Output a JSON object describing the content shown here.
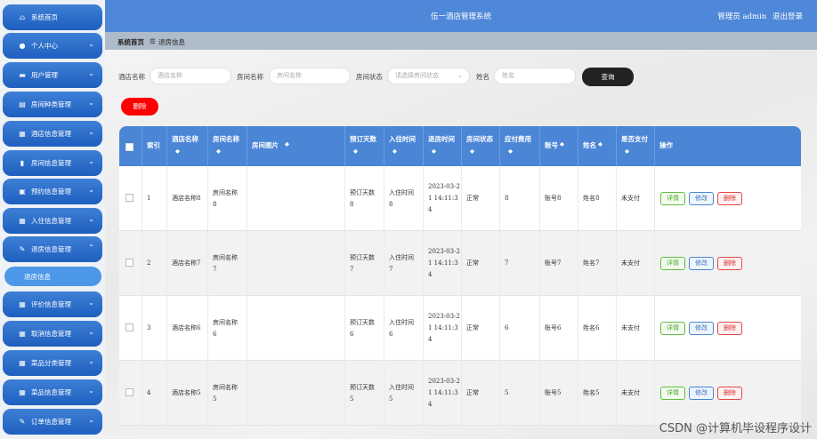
{
  "app_title": "伍一酒店管理系统",
  "user_text": "管理员 admin",
  "logout": "退出登录",
  "breadcrumb": {
    "home": "系统首页",
    "sep": "☰",
    "current": "退房信息"
  },
  "sidebar": {
    "items": [
      {
        "label": "系统首页",
        "icon": "home-icon"
      },
      {
        "label": "个人中心",
        "icon": "person-icon"
      },
      {
        "label": "用户管理",
        "icon": "briefcase-icon"
      },
      {
        "label": "房间种类管理",
        "icon": "bed-icon"
      },
      {
        "label": "酒店信息管理",
        "icon": "grid-icon"
      },
      {
        "label": "房间信息管理",
        "icon": "chart-icon"
      },
      {
        "label": "预约信息管理",
        "icon": "stack-icon"
      },
      {
        "label": "入住信息管理",
        "icon": "grid-icon"
      },
      {
        "label": "退房信息管理",
        "icon": "edit-icon"
      },
      {
        "label": "评价信息管理",
        "icon": "grid-icon"
      },
      {
        "label": "取消信息管理",
        "icon": "grid-icon"
      },
      {
        "label": "菜品分类管理",
        "icon": "grid-icon"
      },
      {
        "label": "菜品信息管理",
        "icon": "grid-icon"
      },
      {
        "label": "订单信息管理",
        "icon": "edit-icon"
      }
    ],
    "sub_active": "退房信息"
  },
  "search": {
    "hotel_label": "酒店名称",
    "hotel_placeholder": "酒店名称",
    "room_label": "房间名称",
    "room_placeholder": "房间名称",
    "status_label": "房间状态",
    "status_placeholder": "请选择房间状态",
    "name_label": "姓名",
    "name_placeholder": "姓名",
    "search_button": "查询"
  },
  "delete_button": "删除",
  "table": {
    "headers": [
      "索引",
      "酒店名称",
      "房间名称",
      "房间图片",
      "预订天数",
      "入住时间",
      "退房时间",
      "房间状态",
      "应付费用",
      "账号",
      "姓名",
      "是否支付",
      "操作"
    ],
    "sort_mark": "◆",
    "rows": [
      {
        "idx": "1",
        "hotel": "酒店名称8",
        "room1": "房间名称",
        "room2": "8",
        "days1": "预订天数",
        "days2": "8",
        "in1": "入住时间",
        "in2": "8",
        "out1": "2023-03-2",
        "out2": "1 14:11:3",
        "out3": "4",
        "status": "正常",
        "fee": "8",
        "acct": "账号8",
        "name": "姓名8",
        "paid": "未支付"
      },
      {
        "idx": "2",
        "hotel": "酒店名称7",
        "room1": "房间名称",
        "room2": "7",
        "days1": "预订天数",
        "days2": "7",
        "in1": "入住时间",
        "in2": "7",
        "out1": "2023-03-2",
        "out2": "1 14:11:3",
        "out3": "4",
        "status": "正常",
        "fee": "7",
        "acct": "账号7",
        "name": "姓名7",
        "paid": "未支付"
      },
      {
        "idx": "3",
        "hotel": "酒店名称6",
        "room1": "房间名称",
        "room2": "6",
        "days1": "预订天数",
        "days2": "6",
        "in1": "入住时间",
        "in2": "6",
        "out1": "2023-03-2",
        "out2": "1 14:11:3",
        "out3": "4",
        "status": "正常",
        "fee": "6",
        "acct": "账号6",
        "name": "姓名6",
        "paid": "未支付"
      },
      {
        "idx": "4",
        "hotel": "酒店名称5",
        "room1": "房间名称",
        "room2": "5",
        "days1": "预订天数",
        "days2": "5",
        "in1": "入住时间",
        "in2": "5",
        "out1": "2023-03-2",
        "out2": "1 14:11:3",
        "out3": "4",
        "status": "正常",
        "fee": "5",
        "acct": "账号5",
        "name": "姓名5",
        "paid": "未支付"
      }
    ],
    "actions": {
      "detail": "详情",
      "edit": "修改",
      "delete": "删除"
    }
  },
  "watermark": "CSDN @计算机毕设程序设计"
}
